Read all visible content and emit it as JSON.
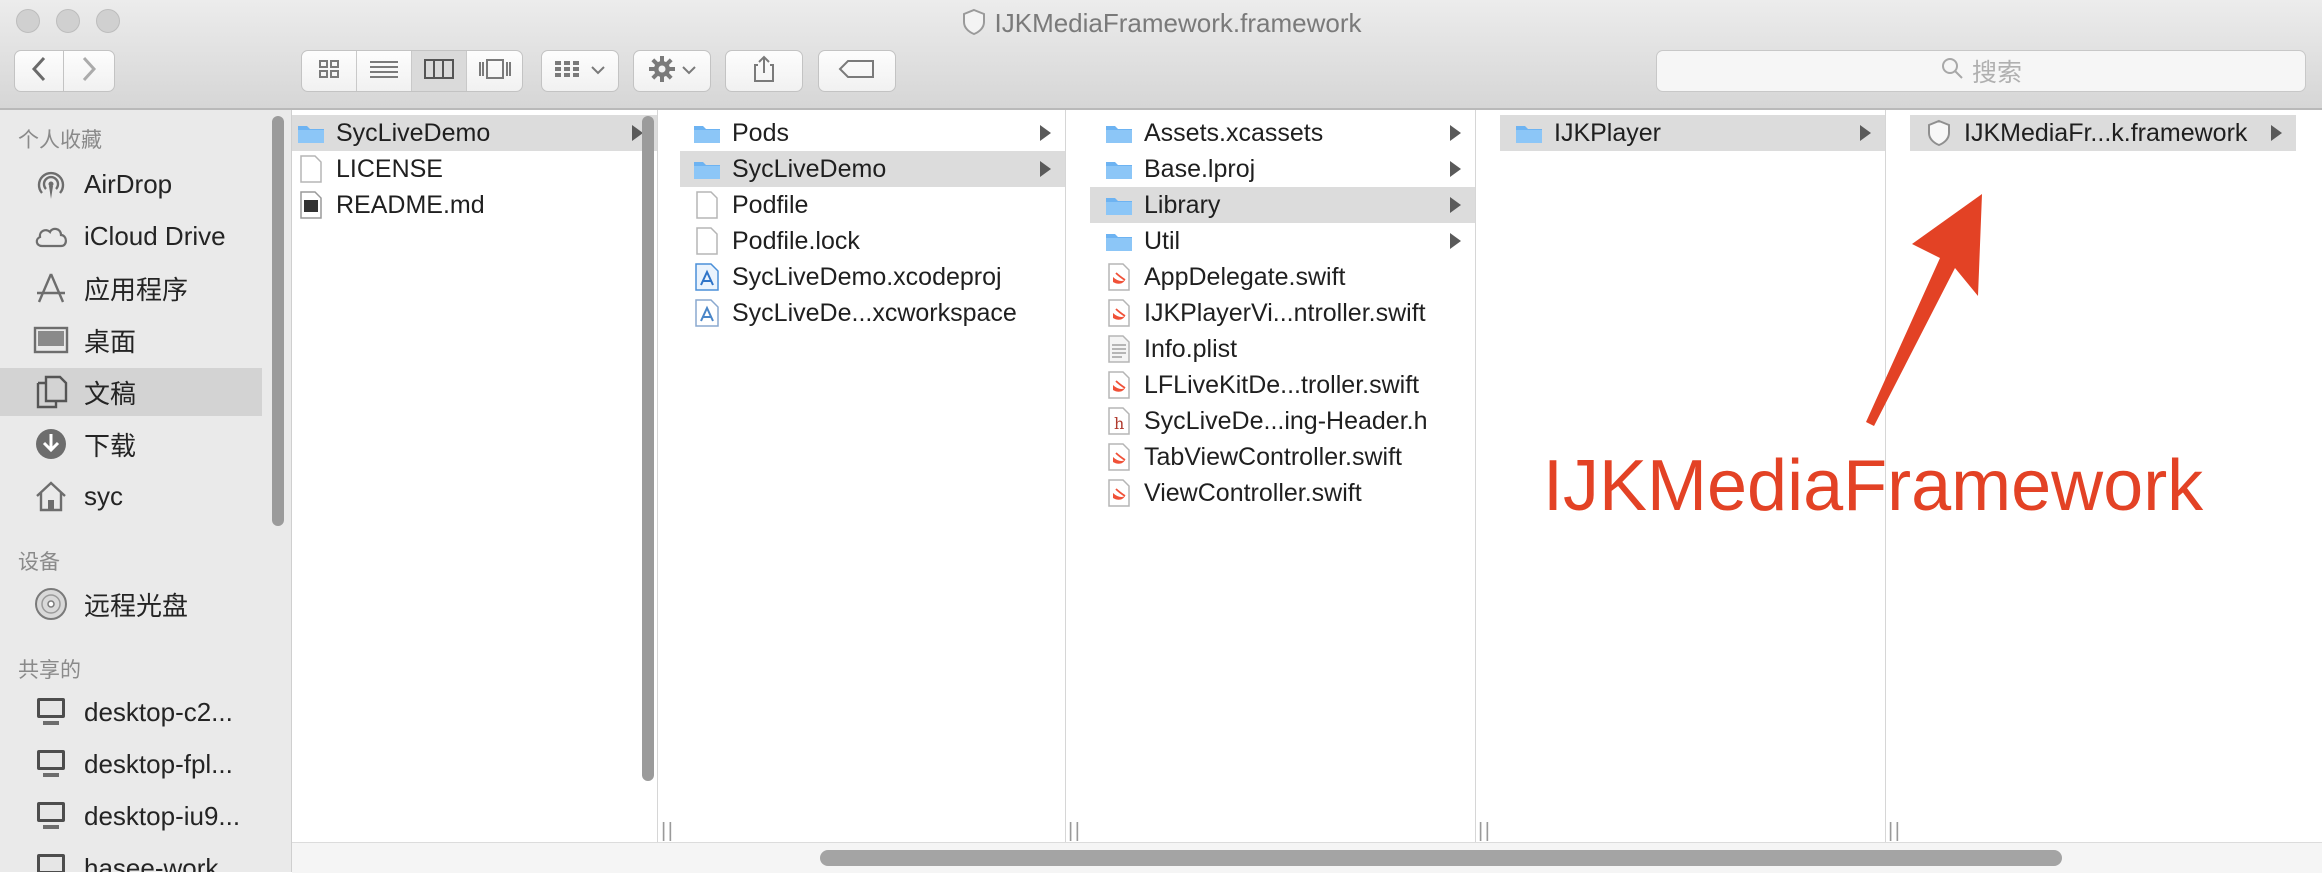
{
  "window": {
    "title": "IJKMediaFramework.framework"
  },
  "toolbar": {
    "back_icon": "chevron-left-icon",
    "forward_icon": "chevron-right-icon",
    "view_modes": [
      "icon-view-icon",
      "list-view-icon",
      "column-view-icon",
      "cover-flow-icon"
    ],
    "active_view": "column-view-icon",
    "group_icon": "group-grid-icon",
    "action_icon": "gear-icon",
    "share_icon": "share-icon",
    "tag_icon": "tag-icon",
    "search_placeholder": "搜索"
  },
  "sidebar": {
    "sections": [
      {
        "header": "个人收藏",
        "items": [
          {
            "label": "AirDrop",
            "icon": "airdrop-icon"
          },
          {
            "label": "iCloud Drive",
            "icon": "cloud-icon"
          },
          {
            "label": "应用程序",
            "icon": "applications-icon"
          },
          {
            "label": "桌面",
            "icon": "desktop-icon"
          },
          {
            "label": "文稿",
            "icon": "documents-icon",
            "selected": true
          },
          {
            "label": "下载",
            "icon": "download-icon"
          },
          {
            "label": "syc",
            "icon": "home-icon"
          }
        ]
      },
      {
        "header": "设备",
        "items": [
          {
            "label": "远程光盘",
            "icon": "disc-icon"
          }
        ]
      },
      {
        "header": "共享的",
        "items": [
          {
            "label": "desktop-c2...",
            "icon": "computer-icon"
          },
          {
            "label": "desktop-fpl...",
            "icon": "computer-icon"
          },
          {
            "label": "desktop-iu9...",
            "icon": "computer-icon"
          },
          {
            "label": "hasee-work...",
            "icon": "computer-icon"
          }
        ]
      }
    ]
  },
  "columns": [
    {
      "items": [
        {
          "name": "SycLiveDemo",
          "type": "folder",
          "selected": true,
          "has_children": true
        },
        {
          "name": "LICENSE",
          "type": "document"
        },
        {
          "name": "README.md",
          "type": "markdown"
        }
      ]
    },
    {
      "items": [
        {
          "name": "Pods",
          "type": "folder",
          "has_children": true
        },
        {
          "name": "SycLiveDemo",
          "type": "folder",
          "selected": true,
          "has_children": true
        },
        {
          "name": "Podfile",
          "type": "document"
        },
        {
          "name": "Podfile.lock",
          "type": "document"
        },
        {
          "name": "SycLiveDemo.xcodeproj",
          "type": "xcodeproj"
        },
        {
          "name": "SycLiveDe...xcworkspace",
          "type": "xcworkspace"
        }
      ]
    },
    {
      "items": [
        {
          "name": "Assets.xcassets",
          "type": "folder",
          "has_children": true
        },
        {
          "name": "Base.lproj",
          "type": "folder",
          "has_children": true
        },
        {
          "name": "Library",
          "type": "folder",
          "selected": true,
          "has_children": true
        },
        {
          "name": "Util",
          "type": "folder",
          "has_children": true
        },
        {
          "name": "AppDelegate.swift",
          "type": "swift"
        },
        {
          "name": "IJKPlayerVi...ntroller.swift",
          "type": "swift"
        },
        {
          "name": "Info.plist",
          "type": "plist"
        },
        {
          "name": "LFLiveKitDe...troller.swift",
          "type": "swift"
        },
        {
          "name": "SycLiveDe...ing-Header.h",
          "type": "header"
        },
        {
          "name": "TabViewController.swift",
          "type": "swift"
        },
        {
          "name": "ViewController.swift",
          "type": "swift"
        }
      ]
    },
    {
      "items": [
        {
          "name": "IJKPlayer",
          "type": "folder",
          "selected": true,
          "has_children": true
        }
      ]
    },
    {
      "items": [
        {
          "name": "IJKMediaFr...k.framework",
          "type": "framework",
          "selected": true,
          "has_children": true
        }
      ]
    }
  ],
  "annotation": {
    "text": "IJKMediaFramework",
    "color": "#e34225"
  },
  "colors": {
    "folder": "#6db3f2",
    "selection": "#dcdcdc",
    "annotation": "#e34225"
  }
}
